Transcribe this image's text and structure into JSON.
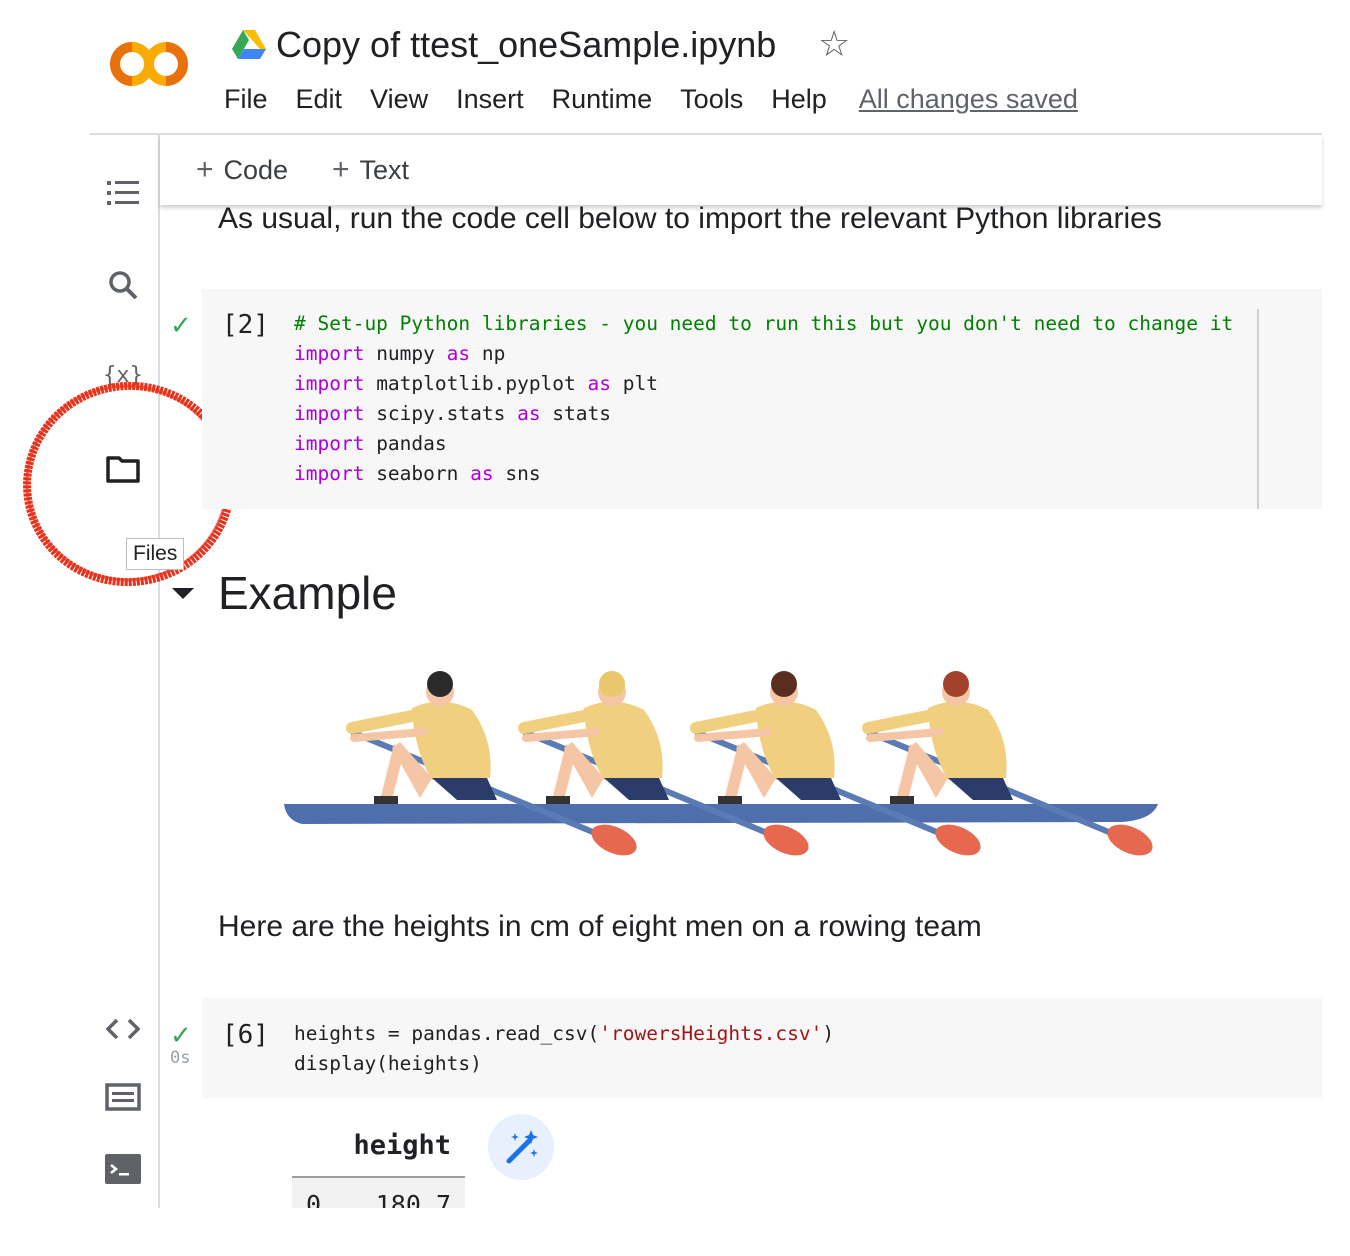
{
  "header": {
    "title": "Copy of ttest_oneSample.ipynb",
    "menu": [
      "File",
      "Edit",
      "View",
      "Insert",
      "Runtime",
      "Tools",
      "Help"
    ],
    "save_status": "All changes saved",
    "logo_text": "CO"
  },
  "toolbar": {
    "add_code": "Code",
    "add_text": "Text",
    "plus": "+"
  },
  "sidebar": {
    "icons": [
      "table-of-contents-icon",
      "search-icon",
      "variables-icon",
      "folder-icon",
      "code-snippets-icon",
      "command-palette-icon",
      "terminal-icon"
    ],
    "variables_glyph": "{x}",
    "files_tooltip": "Files"
  },
  "cells": {
    "intro_text": "As usual, run the code cell below to import the relevant Python libraries",
    "code1": {
      "exec_count": "[2]",
      "comment": "# Set-up Python libraries - you need to run this but you don't need to change it",
      "lines": [
        {
          "kw": "import",
          "mod": " numpy ",
          "as": "as",
          "alias": " np"
        },
        {
          "kw": "import",
          "mod": " matplotlib.pyplot ",
          "as": "as",
          "alias": " plt"
        },
        {
          "kw": "import",
          "mod": " scipy.stats ",
          "as": "as",
          "alias": " stats"
        },
        {
          "kw": "import",
          "mod": " pandas",
          "as": "",
          "alias": ""
        },
        {
          "kw": "import",
          "mod": " seaborn ",
          "as": "as",
          "alias": " sns"
        }
      ]
    },
    "heading": "Example",
    "heights_text": "Here are the heights in cm of eight men on a rowing team",
    "code2": {
      "exec_count": "[6]",
      "exec_time": "0s",
      "line1_pre": "heights = pandas.read_csv(",
      "line1_str": "'rowersHeights.csv'",
      "line1_post": ")",
      "line2": "display(heights)"
    },
    "output": {
      "column": "height",
      "row_index": "0",
      "row_value": "180.7"
    }
  },
  "colors": {
    "check": "#34a853",
    "keyword": "#af00db",
    "comment": "#008000",
    "string": "#a31515",
    "annotation": "#e8331c"
  }
}
